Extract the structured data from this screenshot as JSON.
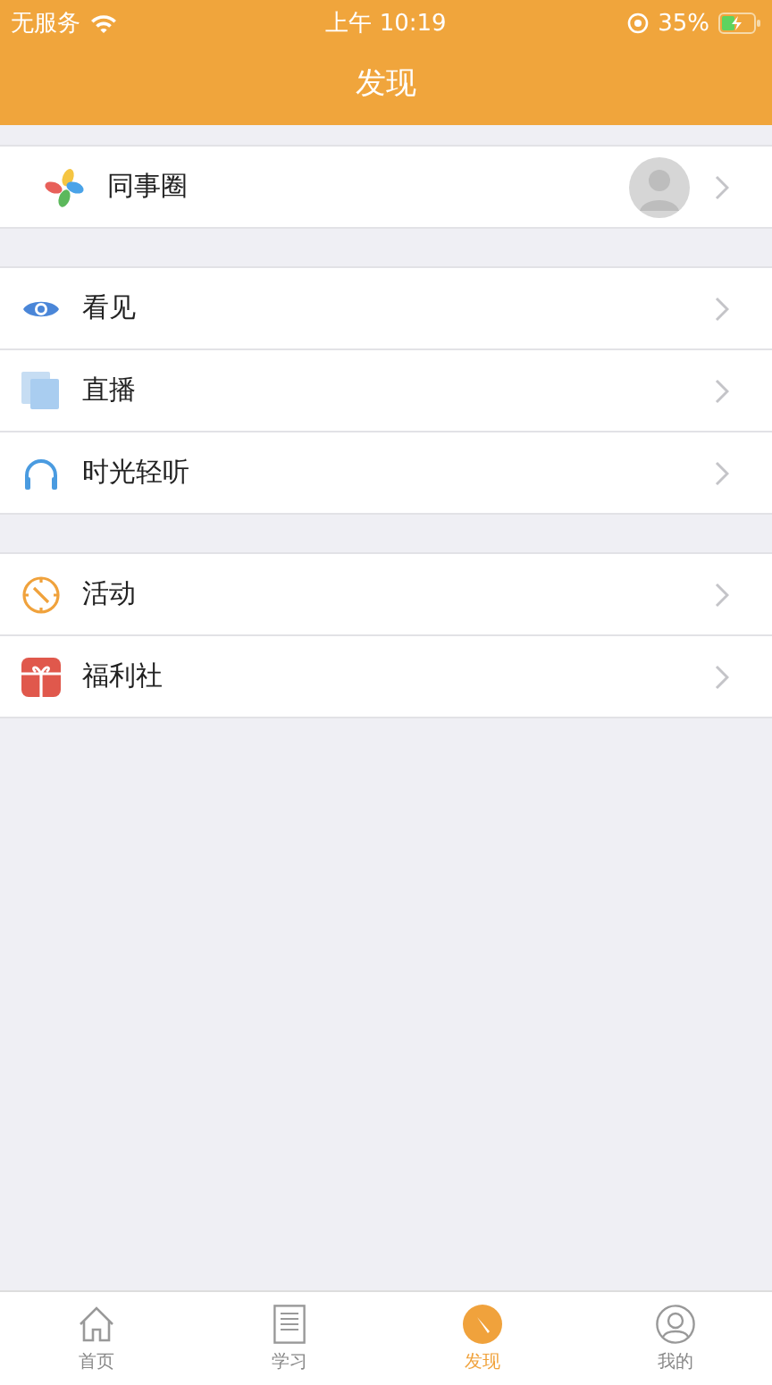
{
  "status_bar": {
    "carrier": "无服务",
    "time": "上午 10:19",
    "battery": "35%"
  },
  "header": {
    "title": "发现"
  },
  "sections": [
    {
      "items": [
        {
          "kind": "pinwheel",
          "label": "同事圈",
          "avatar": true
        }
      ]
    },
    {
      "items": [
        {
          "kind": "eye",
          "label": "看见",
          "avatar": false
        },
        {
          "kind": "live",
          "label": "直播",
          "avatar": false
        },
        {
          "kind": "headphones",
          "label": "时光轻听",
          "avatar": false
        }
      ]
    },
    {
      "items": [
        {
          "kind": "compass",
          "label": "活动",
          "avatar": false
        },
        {
          "kind": "gift",
          "label": "福利社",
          "avatar": false
        }
      ]
    }
  ],
  "tab_bar": [
    {
      "kind": "home",
      "label": "首页",
      "selected": false
    },
    {
      "kind": "study",
      "label": "学习",
      "selected": false
    },
    {
      "kind": "discover",
      "label": "发现",
      "selected": true
    },
    {
      "kind": "profile",
      "label": "我的",
      "selected": false
    }
  ]
}
